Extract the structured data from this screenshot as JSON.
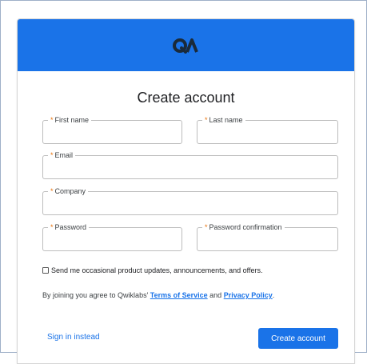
{
  "brand": {
    "logo_text": "QA",
    "header_color": "#1a73e8"
  },
  "form": {
    "title": "Create account",
    "required_marker": "*",
    "fields": {
      "first_name": "First name",
      "last_name": "Last name",
      "email": "Email",
      "company": "Company",
      "password": "Password",
      "password_confirmation": "Password confirmation"
    },
    "checkbox_label": "Send me occasional product updates, announcements, and offers.",
    "checkbox_checked": false,
    "terms": {
      "prefix": "By joining you agree to Qwiklabs' ",
      "tos_link": "Terms of Service",
      "middle": " and ",
      "privacy_link": "Privacy Policy",
      "suffix": "."
    },
    "sign_in_link": "Sign in instead",
    "submit_label": "Create account"
  }
}
